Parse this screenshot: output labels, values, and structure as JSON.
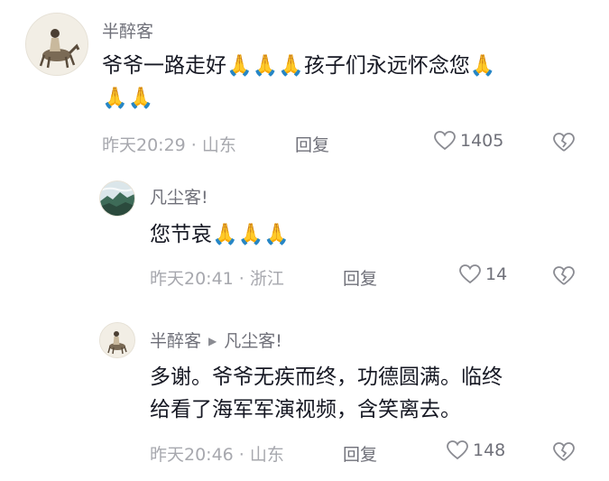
{
  "comments": [
    {
      "username": "半醉客",
      "text_line1": "爷爷一路走好🙏🙏🙏孩子们永远怀念您🙏",
      "text_line2": "🙏🙏",
      "time": "昨天20:29",
      "location": "山东",
      "reply_label": "回复",
      "likes": "1405"
    },
    {
      "username": "凡尘客!",
      "text_line1": "您节哀🙏🙏🙏",
      "time": "昨天20:41",
      "location": "浙江",
      "reply_label": "回复",
      "likes": "14"
    },
    {
      "username": "半醉客",
      "reply_to": "凡尘客!",
      "text_line1": "多谢。爷爷无疾而终，功德圆满。临终",
      "text_line2": "给看了海军军演视频，含笑离去。",
      "time": "昨天20:46",
      "location": "山东",
      "reply_label": "回复",
      "likes": "148"
    }
  ],
  "icons": {
    "like": "heart-outline-icon",
    "dislike": "broken-heart-icon",
    "reply_arrow": "triangle-right-icon"
  },
  "colors": {
    "text": "#161823",
    "username": "#6f7079",
    "meta": "#a7a8ae"
  }
}
